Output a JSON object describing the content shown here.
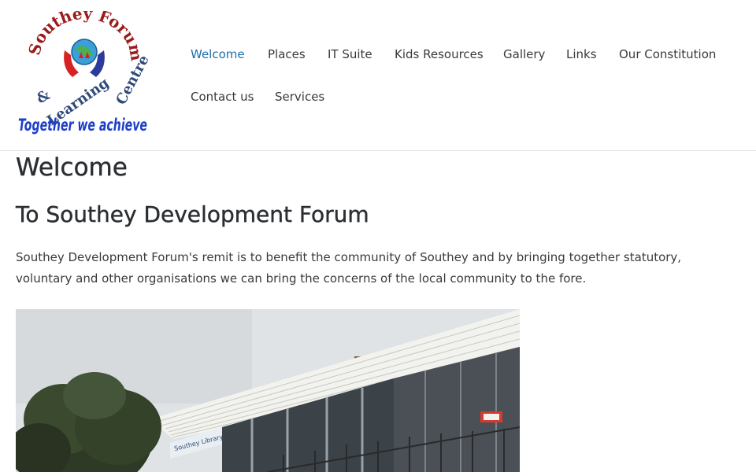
{
  "logo": {
    "arc_text": "Southey Forum & Learning Centre",
    "tagline": "Together we achieve"
  },
  "nav": {
    "items": [
      {
        "label": "Welcome",
        "active": true
      },
      {
        "label": "Places",
        "active": false
      },
      {
        "label": "IT Suite",
        "active": false
      },
      {
        "label": "Kids Resources",
        "active": false
      },
      {
        "label": "Gallery",
        "active": false
      },
      {
        "label": "Links",
        "active": false
      },
      {
        "label": "Our Constitution",
        "active": false
      },
      {
        "label": "Contact us",
        "active": false
      },
      {
        "label": "Services",
        "active": false
      }
    ]
  },
  "main": {
    "title": "Welcome",
    "subtitle": "To Southey Development Forum",
    "intro": "Southey Development Forum's remit is to benefit the community of Southey and by bringing together statutory, voluntary and other organisations we can bring the concerns of the local community to the fore.",
    "photo_sign": "Southey Library"
  },
  "colors": {
    "nav_active": "#1e6fa8",
    "nav_default": "#3a3a3a",
    "heading": "#2b2f33"
  }
}
